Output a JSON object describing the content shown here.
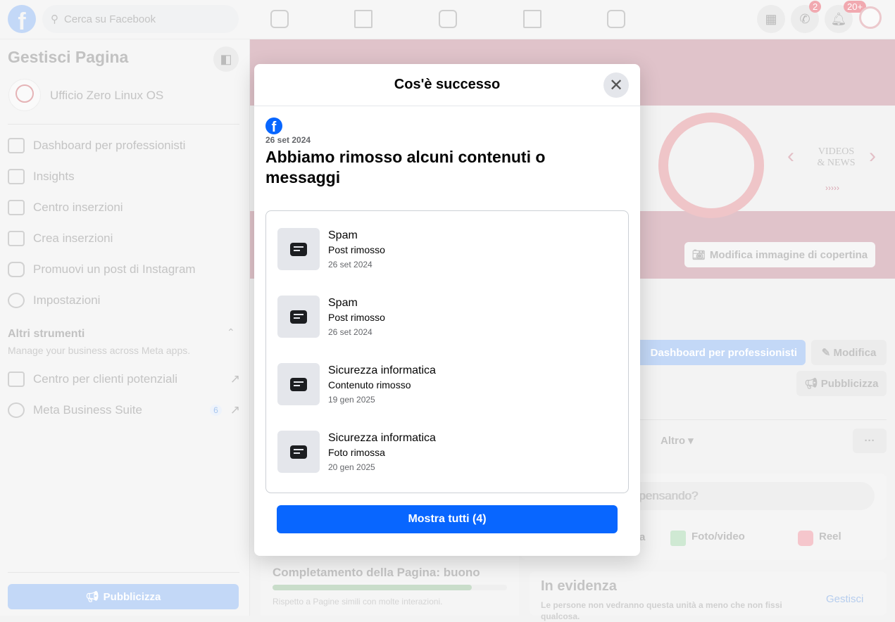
{
  "topbar": {
    "search_placeholder": "Cerca su Facebook",
    "messenger_badge": "2",
    "notifications_badge": "20+"
  },
  "sidebar": {
    "title": "Gestisci Pagina",
    "page_name": "Ufficio Zero Linux OS",
    "items": [
      {
        "label": "Dashboard per professionisti"
      },
      {
        "label": "Insights"
      },
      {
        "label": "Centro inserzioni"
      },
      {
        "label": "Crea inserzioni"
      },
      {
        "label": "Promuovi un post di Instagram"
      },
      {
        "label": "Impostazioni"
      }
    ],
    "tools_title": "Altri strumenti",
    "tools_subtitle": "Manage your business across Meta apps.",
    "tools": [
      {
        "label": "Centro per clienti potenziali"
      },
      {
        "label": "Meta Business Suite",
        "count": "6"
      }
    ],
    "promote_button": "Pubblicizza"
  },
  "cover": {
    "banner_text": "VIDEOS & NEWS",
    "banner_chevrons": "›››››",
    "edit_cover_button": "Modifica immagine di copertina"
  },
  "page_actions": {
    "dashboard": "Dashboard per professionisti",
    "edit": "Modifica",
    "promote": "Pubblicizza",
    "more_tab": "Altro",
    "more_button": "···"
  },
  "composer": {
    "placeholder": "A cosa stai pensando?",
    "visible_placeholder": "i pensando?",
    "photo": "Foto/video",
    "reel": "Reel",
    "partial": "a"
  },
  "completion": {
    "title": "Completamento della Pagina: buono",
    "subtitle": "Rispetto a Pagine simili con molte interazioni.",
    "progress_percent": 85
  },
  "featured": {
    "title": "In evidenza",
    "subtitle": "Le persone non vedranno questa unità a meno che non fissi qualcosa.",
    "manage": "Gestisci"
  },
  "modal": {
    "title": "Cos'è successo",
    "date": "26 set 2024",
    "heading": "Abbiamo rimosso alcuni contenuti o messaggi",
    "items": [
      {
        "title": "Spam",
        "status": "Post rimosso",
        "date": "26 set 2024"
      },
      {
        "title": "Spam",
        "status": "Post rimosso",
        "date": "26 set 2024"
      },
      {
        "title": "Sicurezza informatica",
        "status": "Contenuto rimosso",
        "date": "19 gen 2025"
      },
      {
        "title": "Sicurezza informatica",
        "status": "Foto rimossa",
        "date": "20 gen 2025"
      }
    ],
    "show_all_button": "Mostra tutti (4)"
  },
  "colors": {
    "primary": "#0866ff",
    "cover": "#e0c3ca"
  }
}
